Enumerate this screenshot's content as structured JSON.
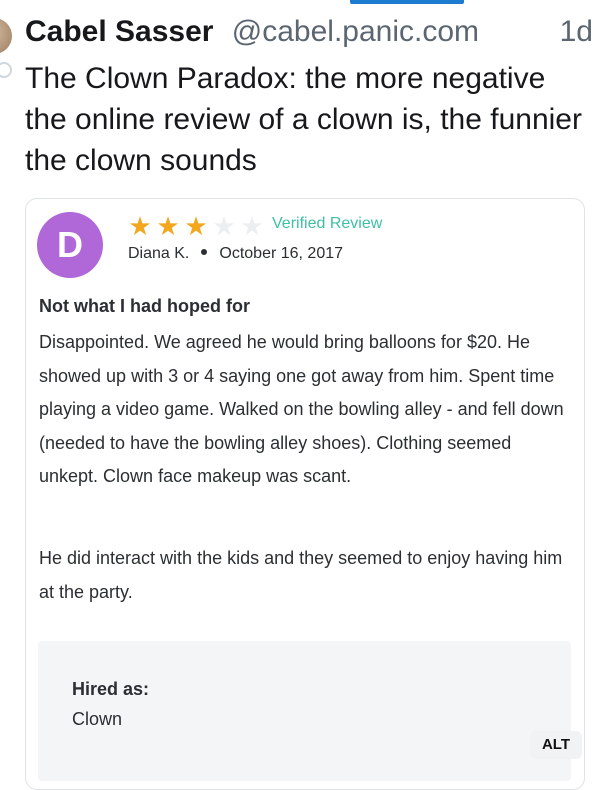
{
  "post": {
    "author_name": "Cabel Sasser",
    "author_handle": "@cabel.panic.com",
    "time": "1d",
    "text": "The Clown Paradox: the more negative the online review of a clown is, the funnier the clown sounds"
  },
  "review": {
    "avatar_letter": "D",
    "rating": 3,
    "rating_max": 5,
    "verified_label": "Verified Review",
    "reviewer": "Diana K.",
    "date": "October 16, 2017",
    "title": "Not what I had hoped for",
    "body_p1": "Disappointed. We agreed he would bring balloons for $20. He showed up with 3 or 4 saying one got away from him. Spent time playing a video game. Walked on the bowling alley - and fell down (needed to have the bowling alley shoes). Clothing seemed unkept. Clown face makeup was scant.",
    "body_p2": "He did interact with the kids and they seemed to enjoy having him at the party.",
    "hired_label": "Hired as:",
    "hired_value": "Clown"
  },
  "alt_badge": "ALT",
  "colors": {
    "accent_bar": "#1d7ccf",
    "avatar": "#b068d9",
    "star_on": "#f2a71e",
    "star_off": "#eceef0",
    "verified": "#3fc0a4"
  },
  "icons": {
    "star": "star-icon",
    "separator": "dot-separator-icon"
  }
}
